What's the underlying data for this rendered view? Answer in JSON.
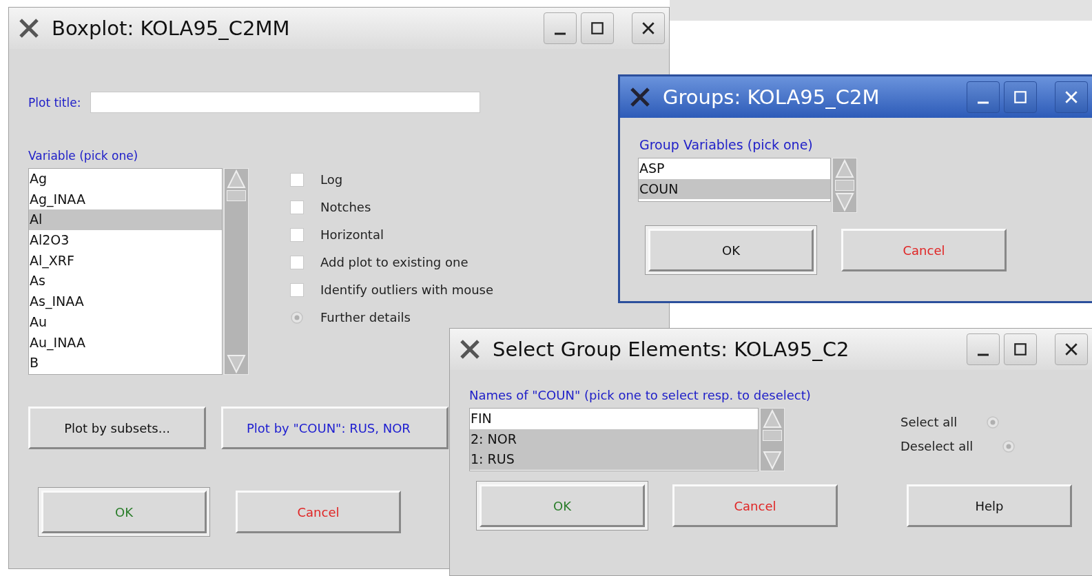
{
  "boxplot_window": {
    "title": "Boxplot: KOLA95_C2MM",
    "active": false,
    "plot_title_label": "Plot title:",
    "variable_label": "Variable (pick one)",
    "variables": [
      {
        "label": "Ag",
        "selected": false
      },
      {
        "label": "Ag_INAA",
        "selected": false
      },
      {
        "label": "Al",
        "selected": true
      },
      {
        "label": "Al2O3",
        "selected": false
      },
      {
        "label": "Al_XRF",
        "selected": false
      },
      {
        "label": "As",
        "selected": false
      },
      {
        "label": "As_INAA",
        "selected": false
      },
      {
        "label": "Au",
        "selected": false
      },
      {
        "label": "Au_INAA",
        "selected": false
      },
      {
        "label": "B",
        "selected": false
      }
    ],
    "options": [
      {
        "kind": "checkbox",
        "label": "Log",
        "checked": false
      },
      {
        "kind": "checkbox",
        "label": "Notches",
        "checked": false
      },
      {
        "kind": "checkbox",
        "label": "Horizontal",
        "checked": false
      },
      {
        "kind": "checkbox",
        "label": "Add plot to existing one",
        "checked": false
      },
      {
        "kind": "checkbox",
        "label": "Identify outliers with mouse",
        "checked": false
      },
      {
        "kind": "radio",
        "label": "Further details",
        "selected": false
      }
    ],
    "subset_buttons": [
      {
        "label": "Plot by subsets...",
        "color": "#111111"
      },
      {
        "label": "Plot by \"COUN\": RUS, NOR",
        "color": "#1c1cd0"
      }
    ],
    "buttons": [
      {
        "label": "OK",
        "color": "#2a7d2a",
        "default": true
      },
      {
        "label": "Cancel",
        "color": "#e02424",
        "default": false
      }
    ]
  },
  "groups_window": {
    "title": "Groups: KOLA95_C2M",
    "active": true,
    "label": "Group Variables (pick one)",
    "items": [
      {
        "label": "ASP",
        "selected": false
      },
      {
        "label": "COUN",
        "selected": true
      }
    ],
    "buttons": [
      {
        "label": "OK",
        "color": "#111111",
        "default": true
      },
      {
        "label": "Cancel",
        "color": "#e02424",
        "default": false
      }
    ]
  },
  "select_window": {
    "title": "Select Group Elements: KOLA95_C2",
    "active": false,
    "label": "Names of \"COUN\" (pick one to select resp. to deselect)",
    "items": [
      {
        "label": "FIN",
        "selected": false
      },
      {
        "label": "2: NOR",
        "selected": true
      },
      {
        "label": "1: RUS",
        "selected": true
      }
    ],
    "radios": [
      {
        "label": "Select all",
        "selected": false
      },
      {
        "label": "Deselect all",
        "selected": false
      }
    ],
    "buttons": [
      {
        "label": "OK",
        "color": "#2a7d2a",
        "default": true
      },
      {
        "label": "Cancel",
        "color": "#e02424",
        "default": false
      },
      {
        "label": "Help",
        "color": "#111111",
        "default": false
      }
    ]
  }
}
